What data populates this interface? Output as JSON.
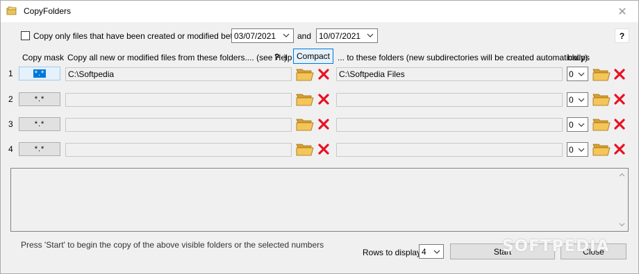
{
  "window": {
    "title": "CopyFolders"
  },
  "filter": {
    "checkbox_label": "Copy only files that have been created or modified between",
    "date_from": "03/07/2021",
    "and_label": "and",
    "date_to": "10/07/2021",
    "help_label": "?"
  },
  "headers": {
    "copy_mask": "Copy mask",
    "source": "Copy all new or modified files from these folders.... (see Help in",
    "help_inline": "?",
    "source_close": ")",
    "compact": "Compact",
    "dest": "... to these folders (new subdirectories will be created automatically)",
    "backups": "bkups"
  },
  "rows": [
    {
      "num": "1",
      "mask": "*.*",
      "source": "C:\\Softpedia",
      "dest": "C:\\Softpedia Files",
      "bkups": "0"
    },
    {
      "num": "2",
      "mask": "*.*",
      "source": "",
      "dest": "",
      "bkups": "0"
    },
    {
      "num": "3",
      "mask": "*.*",
      "source": "",
      "dest": "",
      "bkups": "0"
    },
    {
      "num": "4",
      "mask": "*.*",
      "source": "",
      "dest": "",
      "bkups": "0"
    }
  ],
  "footer": {
    "instruction": "Press 'Start' to begin the copy of the above visible folders or the selected numbers",
    "rows_label": "Rows to display:",
    "rows_value": "4",
    "start": "Start",
    "close": "Close"
  },
  "watermark": "SOFTPEDIA",
  "colors": {
    "window_bg": "#f0f0f0",
    "accent": "#0078d7",
    "folder": "#e8b84a",
    "delete": "#e81123"
  },
  "icons": {
    "app": "copyfolders-app-icon",
    "folder": "folder-open-icon",
    "delete": "red-x-icon",
    "dropdown": "chevron-down-icon"
  }
}
